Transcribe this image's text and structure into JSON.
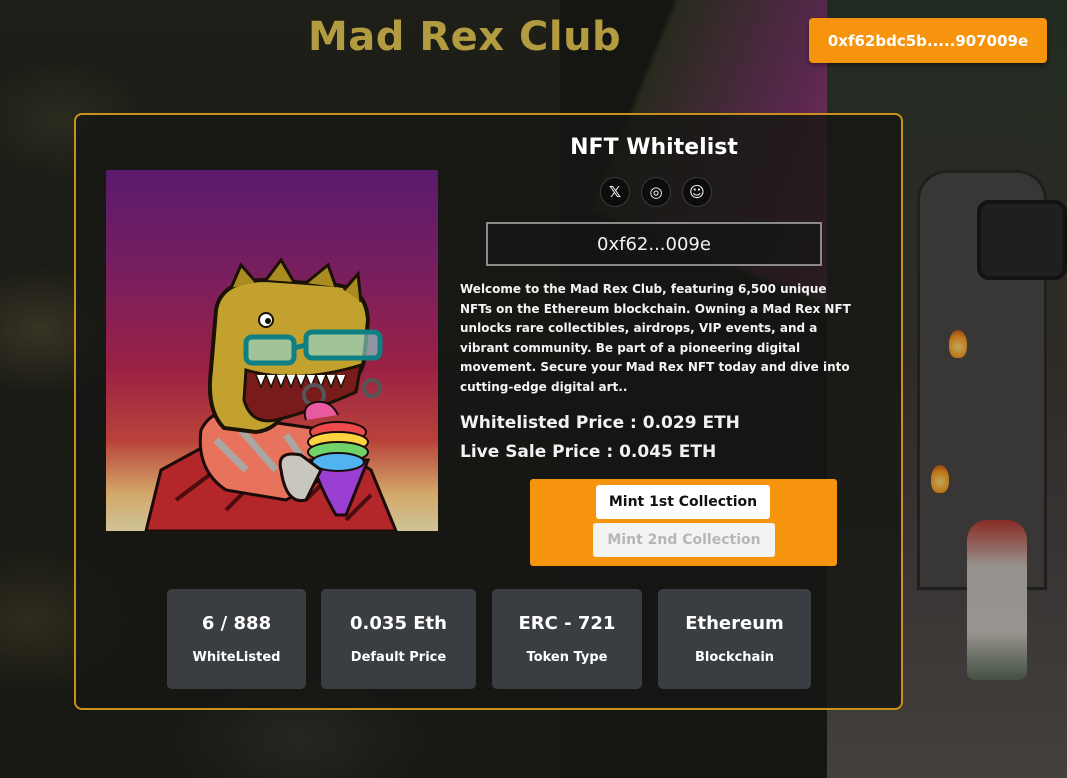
{
  "header": {
    "brand_title": "Mad Rex Club",
    "wallet_button": "0xf62bdc5b.....907009e"
  },
  "card": {
    "title": "NFT Whitelist",
    "socials": [
      {
        "icon": "x-twitter-icon",
        "glyph": "𝕏"
      },
      {
        "icon": "instagram-icon",
        "glyph": "◎"
      },
      {
        "icon": "discord-icon",
        "glyph": "☺"
      }
    ],
    "address": "0xf62...009e",
    "description": "Welcome to the Mad Rex Club, featuring 6,500 unique NFTs on the Ethereum blockchain. Owning a Mad Rex NFT unlocks rare collectibles, airdrops, VIP events, and a vibrant community. Be part of a pioneering digital movement. Secure your Mad Rex NFT today and dive into cutting-edge digital art..",
    "whitelisted_price": "Whitelisted Price : 0.029 ETH",
    "live_sale_price": "Live Sale Price : 0.045 ETH",
    "mint_primary": "Mint 1st Collection",
    "mint_secondary": "Mint 2nd Collection"
  },
  "stats": [
    {
      "value": "6 / 888",
      "label": "WhiteListed"
    },
    {
      "value": "0.035 Eth",
      "label": "Default Price"
    },
    {
      "value": "ERC - 721",
      "label": "Token Type"
    },
    {
      "value": "Ethereum",
      "label": "Blockchain"
    }
  ],
  "colors": {
    "accent": "#f7940d",
    "brand_gold": "#b39b3f",
    "card_border": "#c8901d",
    "stat_bg": "#3a3e42"
  }
}
